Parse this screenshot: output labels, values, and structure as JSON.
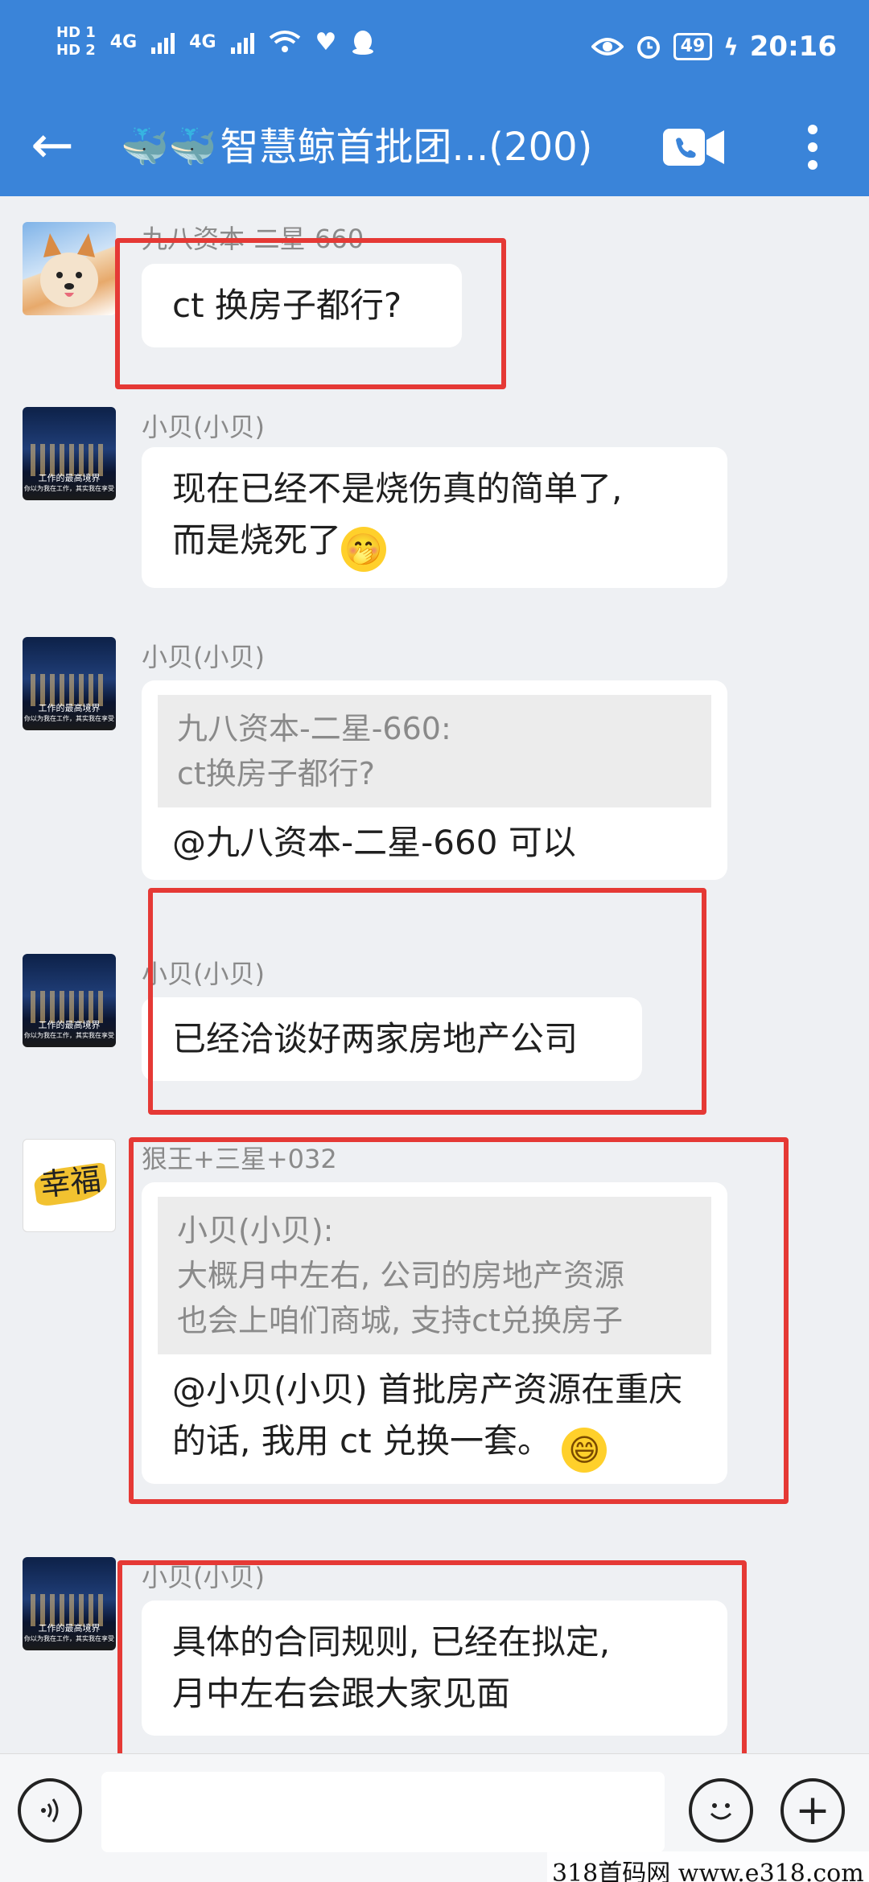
{
  "status_bar": {
    "hd1": "HD 1",
    "hd2": "HD 2",
    "net1": "4G",
    "net2": "4G",
    "battery": "49",
    "time": "20:16"
  },
  "header": {
    "back_icon": "arrow-left-icon",
    "title_emoji": "🐳🐳",
    "title": "智慧鲸首批团...(200)"
  },
  "messages": [
    {
      "sender": "九八资本-二星-660",
      "text": "ct 换房子都行?"
    },
    {
      "sender": "小贝(小贝)",
      "text_line1": "现在已经不是烧伤真的简单了,",
      "text_line2": "而是烧死了",
      "emoji": "🤭"
    },
    {
      "sender": "小贝(小贝)",
      "quote_line1": "九八资本-二星-660:",
      "quote_line2": "ct换房子都行?",
      "text": "@九八资本-二星-660  可以"
    },
    {
      "sender": "小贝(小贝)",
      "text": "已经洽谈好两家房地产公司"
    },
    {
      "sender": "狠王+三星+032",
      "quote_line1": "小贝(小贝):",
      "quote_line2": "大概月中左右, 公司的房地产资源",
      "quote_line3": "也会上咱们商城, 支持ct兑换房子",
      "text_line1": "@小贝(小贝) 首批房产资源在重庆",
      "text_line2": "的话, 我用 ct 兑换一套。",
      "emoji": "😄"
    },
    {
      "sender": "小贝(小贝)",
      "text_line1": "具体的合同规则, 已经在拟定,",
      "text_line2": "月中左右会跟大家见面"
    }
  ],
  "avatar_captions": {
    "city_line1": "工作的最高境界",
    "city_line2": "你以为我在工作，其实我在享受",
    "fortune": "幸福"
  },
  "watermark": "318首码网  www.e318.com"
}
